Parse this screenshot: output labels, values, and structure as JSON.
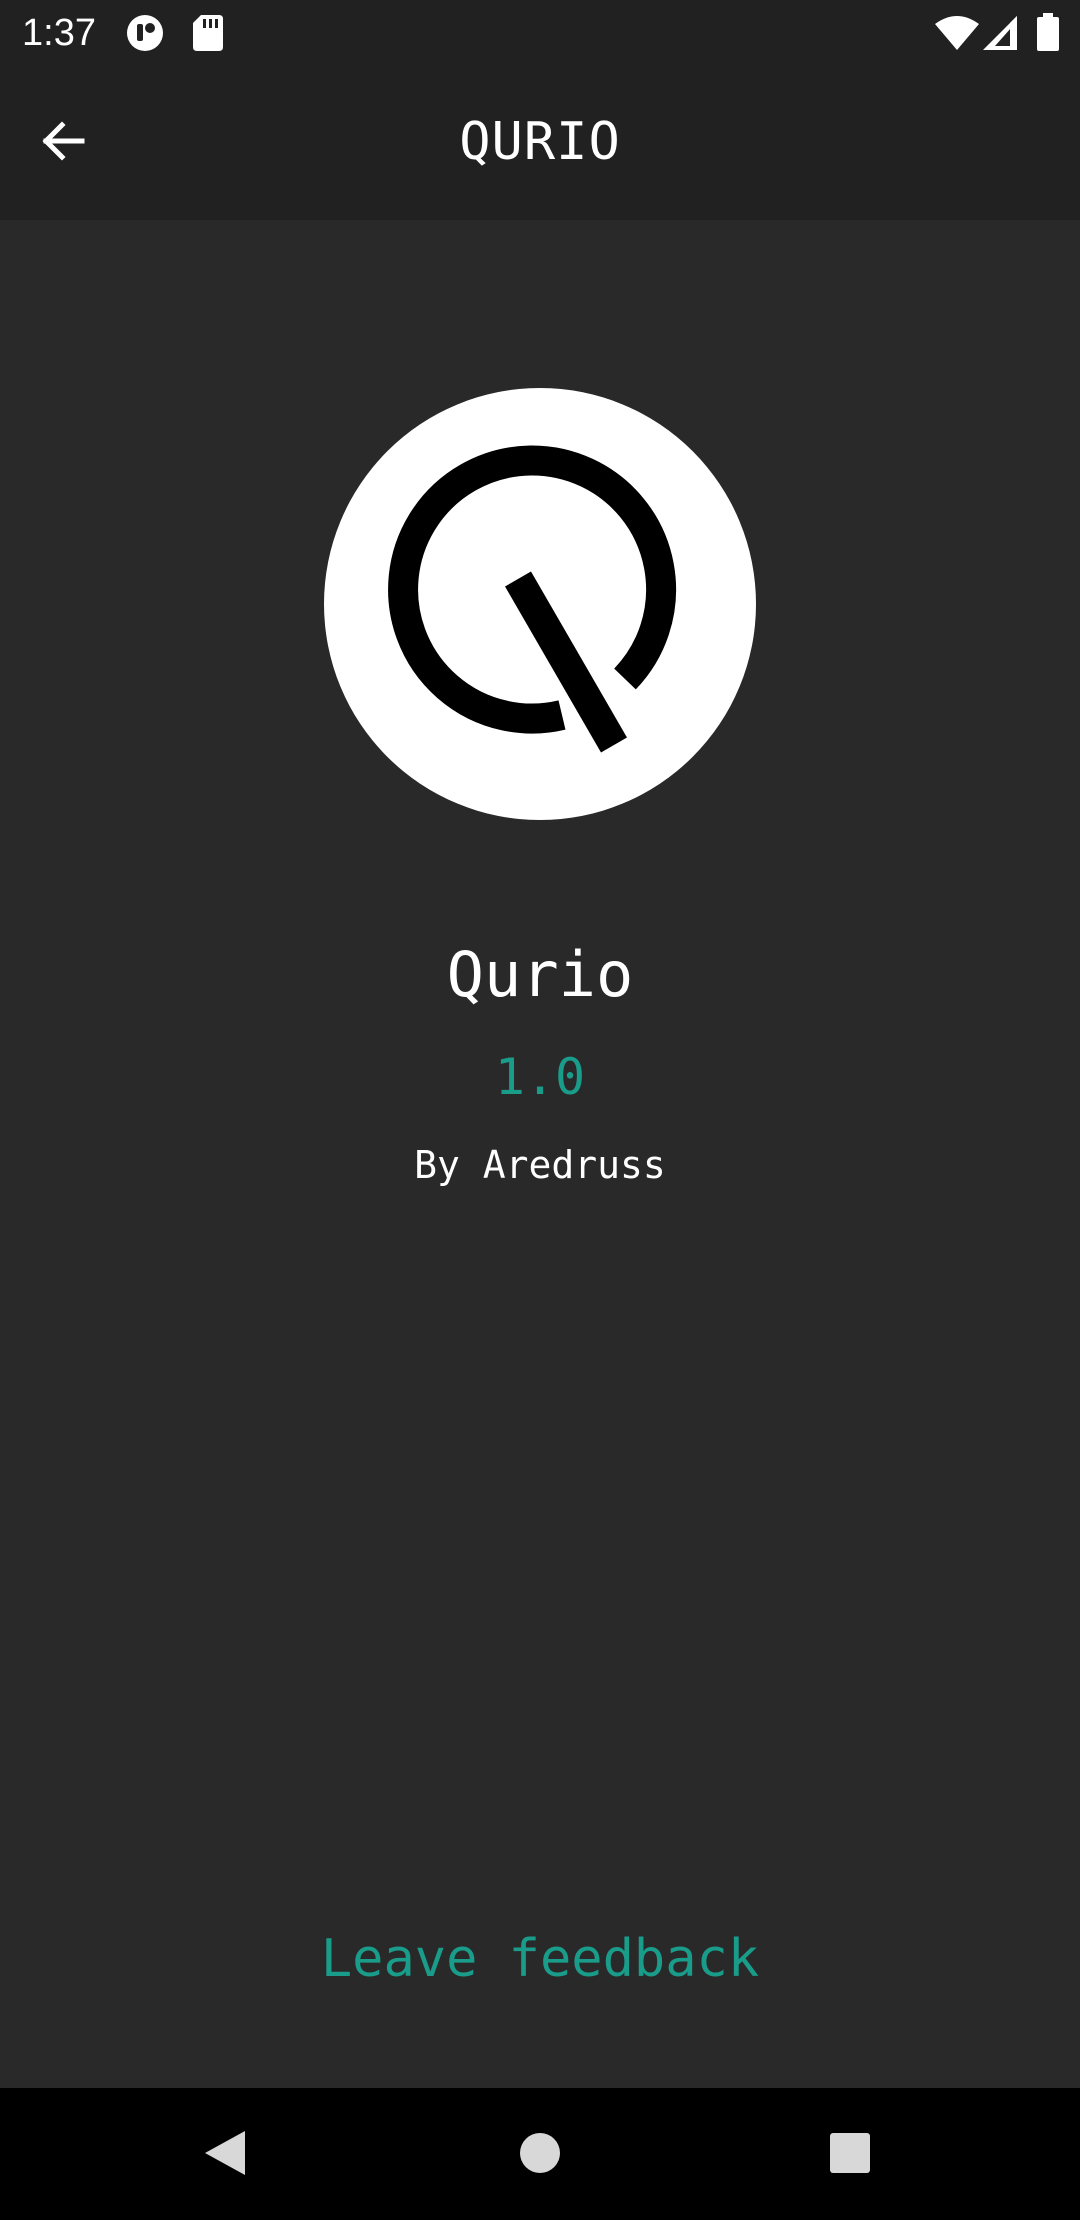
{
  "status_bar": {
    "time": "1:37",
    "icons": [
      "notification-app-icon",
      "sd-card-icon",
      "wifi-icon",
      "signal-icon",
      "battery-icon"
    ]
  },
  "app_bar": {
    "title": "QURIO",
    "back_icon": "arrow-back-icon"
  },
  "about": {
    "logo_icon": "qurio-logo",
    "app_name": "Qurio",
    "version": "1.0",
    "author": "By Aredruss",
    "feedback_label": "Leave feedback"
  },
  "nav_bar": {
    "icons": [
      "back-triangle-icon",
      "home-circle-icon",
      "recents-square-icon"
    ]
  },
  "colors": {
    "background": "#292929",
    "bar": "#212121",
    "accent": "#1a9c8a",
    "text": "#ffffff"
  }
}
